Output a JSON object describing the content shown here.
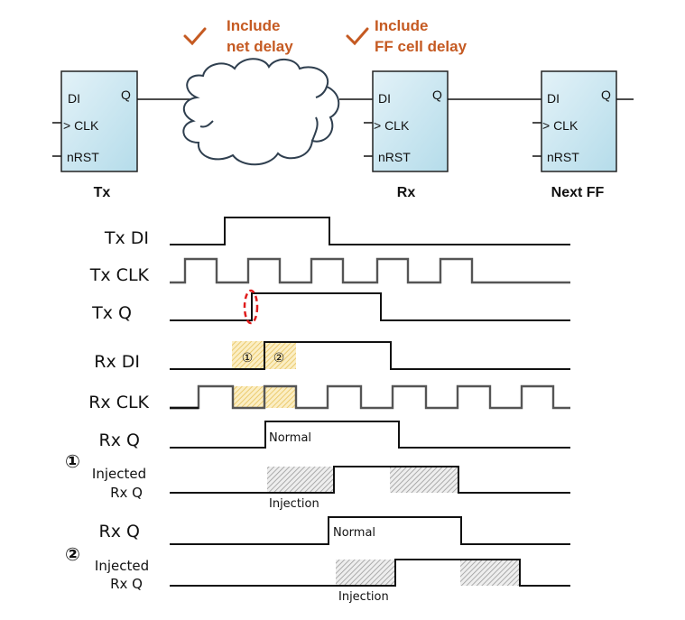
{
  "notes": {
    "net_delay": {
      "icon": "check-icon",
      "line1": "Include",
      "line2": "net delay"
    },
    "ff_delay": {
      "icon": "check-icon",
      "line1": "Include",
      "line2": "FF cell delay"
    },
    "color": "#c55a22"
  },
  "flipflops": [
    {
      "name": "Tx",
      "pins": {
        "di": "DI",
        "q": "Q",
        "clk": "> CLK",
        "rst": "nRST"
      }
    },
    {
      "name": "Rx",
      "pins": {
        "di": "DI",
        "q": "Q",
        "clk": "> CLK",
        "rst": "nRST"
      }
    },
    {
      "name": "Next FF",
      "pins": {
        "di": "DI",
        "q": "Q",
        "clk": "> CLK",
        "rst": "nRST"
      }
    }
  ],
  "colors": {
    "ff_fill_top": "#dff0f7",
    "ff_fill_bottom": "#b9dfec",
    "cloud_stroke": "#2f3f4f",
    "setup_hatch": "#f3d27a",
    "inject_hatch": "#9a9a9a",
    "marker": "#e01b1b"
  },
  "signals": [
    {
      "label": "Tx DI"
    },
    {
      "label": "Tx CLK"
    },
    {
      "label": "Tx Q"
    },
    {
      "label": "Rx DI"
    },
    {
      "label": "Rx CLK"
    },
    {
      "label": "Rx Q",
      "annotation": "Normal"
    },
    {
      "group_marker": "①",
      "label_line1": "Injected",
      "label_line2": "Rx Q",
      "annotation": "Injection"
    },
    {
      "label": "Rx Q",
      "annotation": "Normal"
    },
    {
      "group_marker": "②",
      "label_line1": "Injected",
      "label_line2": "Rx Q",
      "annotation": "Injection"
    }
  ],
  "window_markers": [
    "①",
    "②"
  ]
}
